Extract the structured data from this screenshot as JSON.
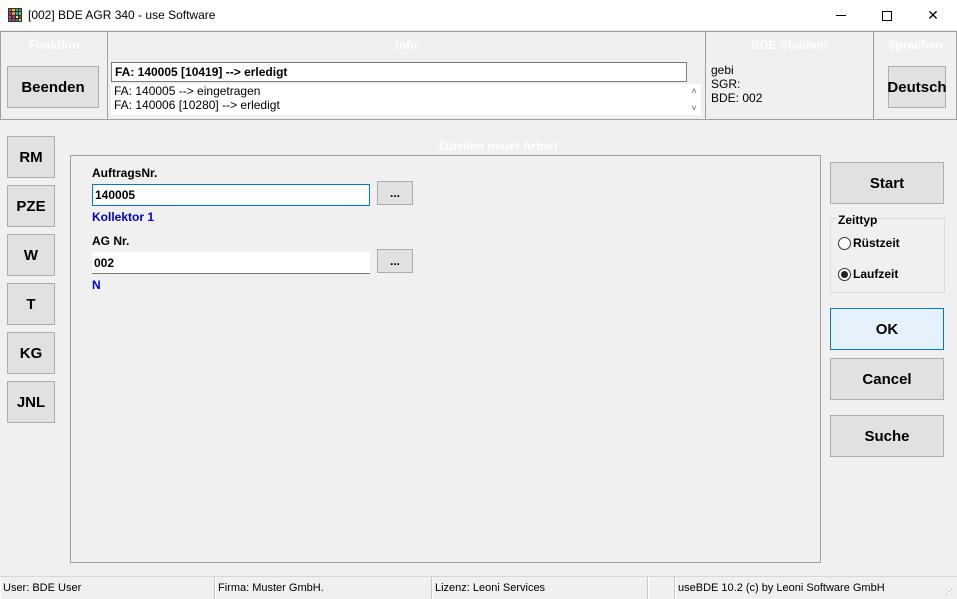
{
  "window": {
    "title": "[002] BDE AGR 340 - use Software",
    "app_icon": "grid-app-icon",
    "controls": {
      "minimize": "minimize-icon",
      "maximize": "maximize-icon",
      "close": "✕"
    }
  },
  "header": {
    "funktion_title": "Funktion",
    "info_title": "Info",
    "station_title": "BDE Statinon",
    "sprachen_title": "Sprachen",
    "beenden_label": "Beenden",
    "deutsch_label": "Deutsch",
    "info_current": "FA: 140005 [10419] --> erledigt",
    "info_lines": [
      "FA: 140005 --> eingetragen",
      "FA: 140006 [10280] --> erledigt"
    ],
    "station_lines": [
      "gebi",
      "SGR:",
      "BDE: 002"
    ]
  },
  "sidebar": {
    "items": [
      {
        "label": "RM"
      },
      {
        "label": "PZE"
      },
      {
        "label": "W"
      },
      {
        "label": "T"
      },
      {
        "label": "KG"
      },
      {
        "label": "JNL"
      }
    ]
  },
  "form": {
    "group_title": "Zuteilen neuer Arbeit",
    "auftrag_label": "AuftragsNr.",
    "auftrag_value": "140005",
    "auftrag_browse": "...",
    "auftrag_hint": "Kollektor 1",
    "ag_label": "AG Nr.",
    "ag_value": "002",
    "ag_browse": "...",
    "ag_hint": "N"
  },
  "actions": {
    "start_label": "Start",
    "zeittyp_title": "Zeittyp",
    "radio_options": [
      {
        "label": "Rüstzeit",
        "checked": false
      },
      {
        "label": "Laufzeit",
        "checked": true
      }
    ],
    "ok_label": "OK",
    "cancel_label": "Cancel",
    "suche_label": "Suche"
  },
  "statusbar": {
    "user": "User: BDE User",
    "firma": "Firma: Muster GmbH.",
    "lizenz": "Lizenz: Leoni Services",
    "empty": "",
    "version": "useBDE 10.2 (c) by Leoni Software GmbH"
  },
  "colors": {
    "accent": "#0078d7",
    "hint_blue": "#0000cc",
    "background": "#f0f0f0"
  }
}
